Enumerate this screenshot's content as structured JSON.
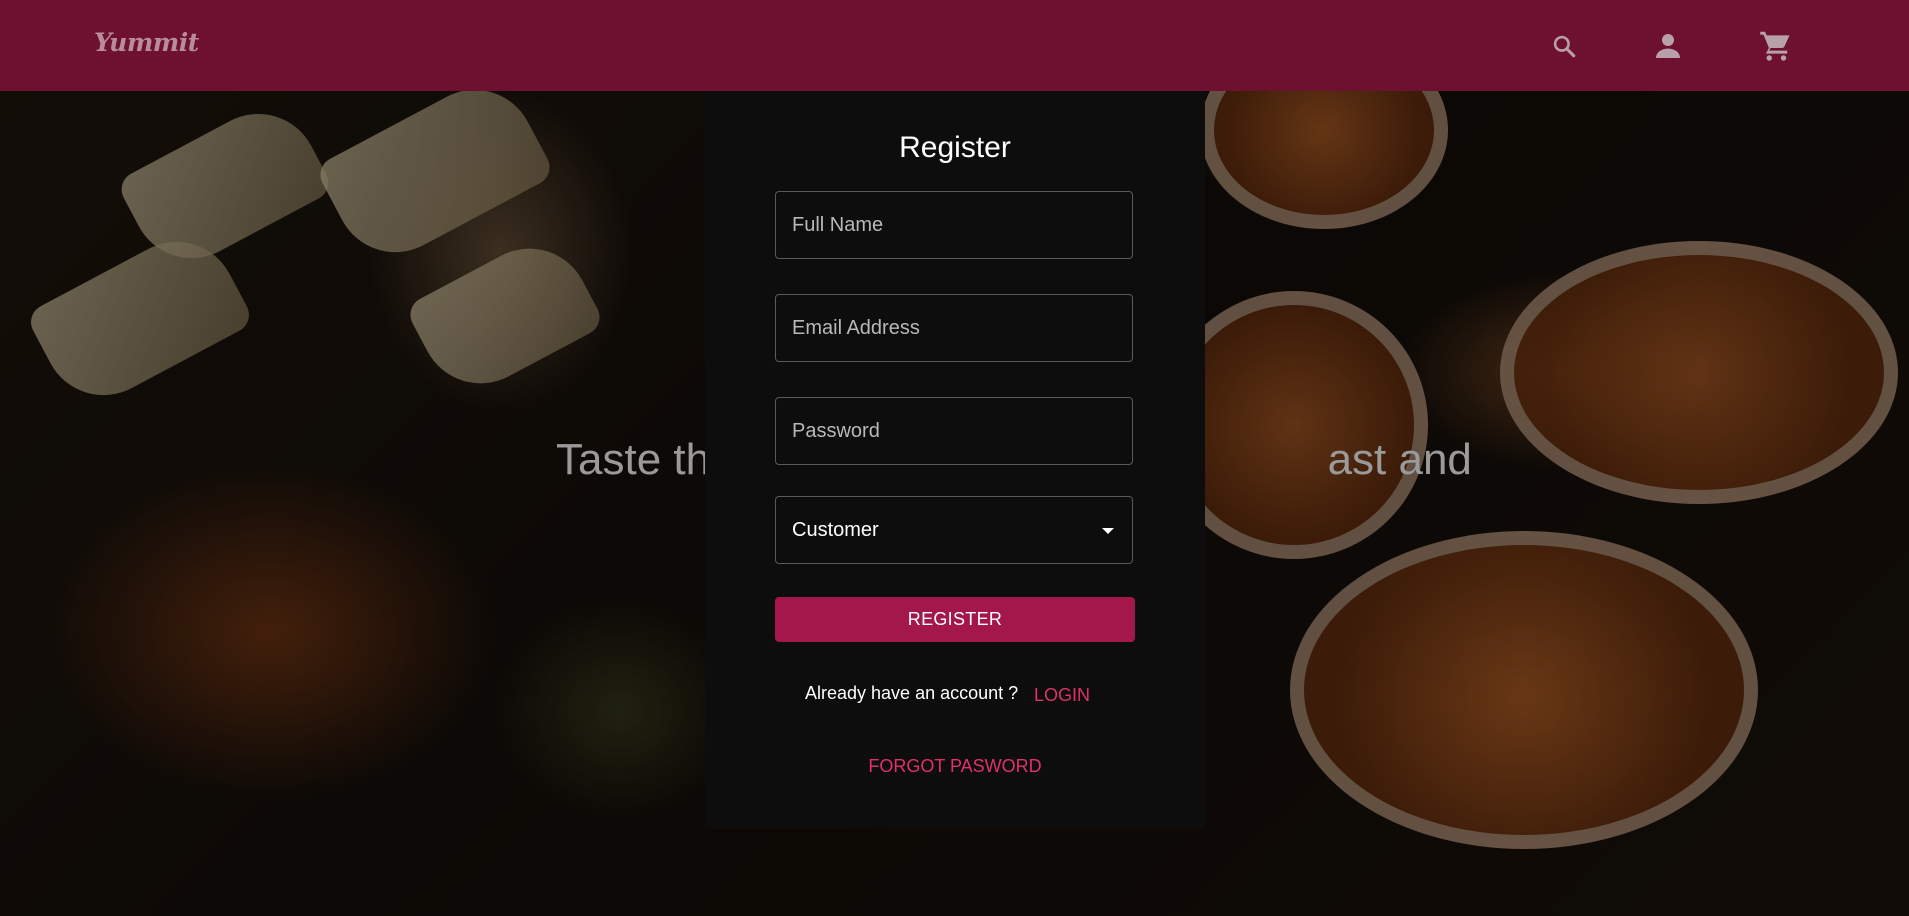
{
  "header": {
    "logo": "Yummit",
    "icons": [
      "search-icon",
      "account-icon",
      "cart-icon"
    ],
    "background_color": "#6e1030"
  },
  "hero": {
    "tagline": "Taste the",
    "tagline_tail": "ast and"
  },
  "register_card": {
    "title": "Register",
    "full_name": {
      "value": "",
      "placeholder": "Full Name"
    },
    "email": {
      "value": "",
      "placeholder": "Email Address"
    },
    "password": {
      "value": "",
      "placeholder": "Password"
    },
    "role_select": {
      "selected": "Customer"
    },
    "register_label": "REGISTER",
    "already_text": "Already have an account ?",
    "login_label": "LOGIN",
    "forgot_label": "FORGOT PASWORD",
    "accent_color": "#a3174a",
    "link_color": "#e0306e"
  }
}
